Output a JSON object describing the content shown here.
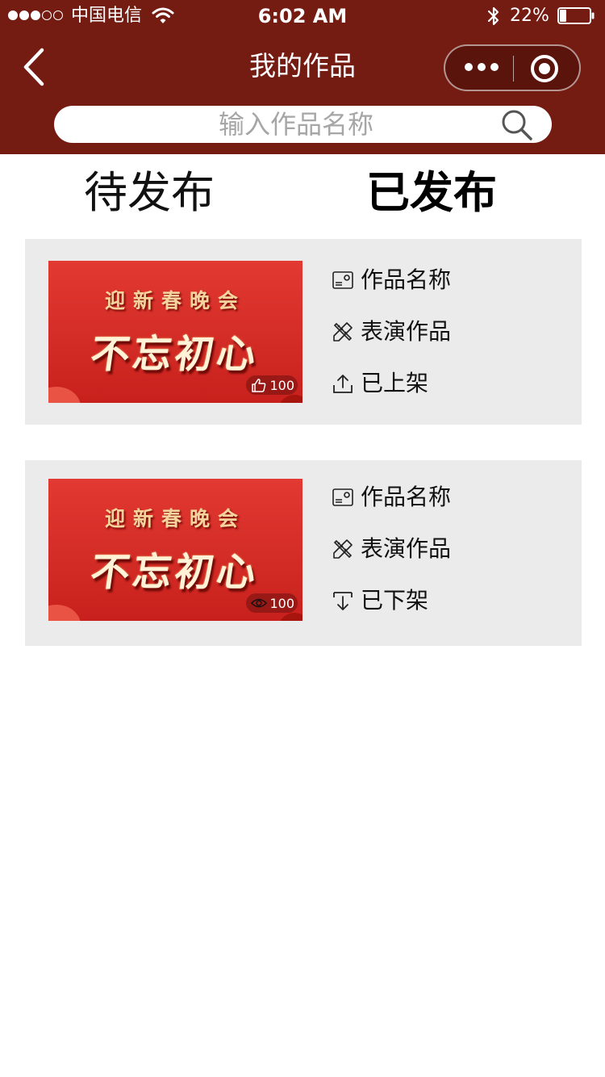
{
  "status_bar": {
    "carrier": "中国电信",
    "time": "6:02 AM",
    "battery_percent": "22%",
    "battery_level": 0.22,
    "signal_bars": 3,
    "signal_total": 5
  },
  "nav": {
    "title": "我的作品",
    "back_icon": "chevron-left-icon",
    "more_icon": "more-dots-icon",
    "close_icon": "target-circle-icon"
  },
  "search": {
    "placeholder": "输入作品名称",
    "value": "",
    "icon": "search-icon"
  },
  "tabs": [
    {
      "label": "待发布",
      "active": false
    },
    {
      "label": "已发布",
      "active": true
    }
  ],
  "works": [
    {
      "thumbnail": {
        "subtitle": "迎新春晚会",
        "title": "不忘初心"
      },
      "stat_icon": "thumbs-up-icon",
      "stat_value": "100",
      "name": "作品名称",
      "type": "表演作品",
      "status": "已上架",
      "status_icon": "upload-icon"
    },
    {
      "thumbnail": {
        "subtitle": "迎新春晚会",
        "title": "不忘初心"
      },
      "stat_icon": "eye-icon",
      "stat_value": "100",
      "name": "作品名称",
      "type": "表演作品",
      "status": "已下架",
      "status_icon": "download-icon"
    }
  ],
  "colors": {
    "header_bg": "#741b12",
    "card_bg": "#ebebeb",
    "thumb_red": "#d42a24"
  }
}
